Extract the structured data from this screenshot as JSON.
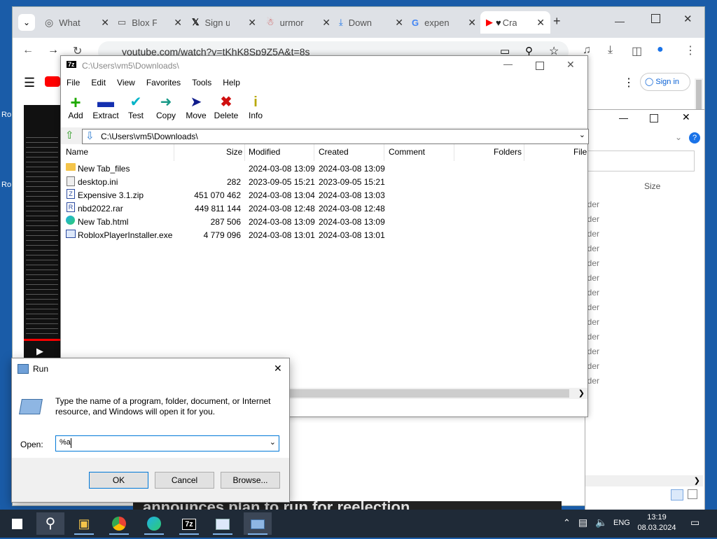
{
  "desktop": {
    "icon1_label": "Ro",
    "icon2_label": "Ro"
  },
  "browser": {
    "tabs": [
      {
        "title": "What",
        "icon": "globe-icon"
      },
      {
        "title": "Blox F",
        "icon": "page-icon"
      },
      {
        "title": "Sign u",
        "icon": "x-logo-icon"
      },
      {
        "title": "urmor",
        "icon": "bot-icon"
      },
      {
        "title": "Down",
        "icon": "download-icon"
      },
      {
        "title": "expen",
        "icon": "google-icon"
      },
      {
        "title": "Cra",
        "icon": "youtube-icon"
      }
    ],
    "url": "youtube.com/watch?v=tKhK8Sp9Z5A&t=8s",
    "sign_in": "Sign in",
    "video_caption": "announces plan to run for reelection"
  },
  "explorer": {
    "size_header": "Size",
    "folder_fragment": "lder",
    "rows": 13
  },
  "sevenzip": {
    "title": "C:\\Users\\vm5\\Downloads\\",
    "menu": [
      "File",
      "Edit",
      "View",
      "Favorites",
      "Tools",
      "Help"
    ],
    "tools": [
      "Add",
      "Extract",
      "Test",
      "Copy",
      "Move",
      "Delete",
      "Info"
    ],
    "address": "C:\\Users\\vm5\\Downloads\\",
    "columns": [
      "Name",
      "Size",
      "Modified",
      "Created",
      "Comment",
      "Folders",
      "File"
    ],
    "files": [
      {
        "name": "New Tab_files",
        "size": "",
        "modified": "2024-03-08 13:09",
        "created": "2024-03-08 13:09",
        "icon": "folder-icon"
      },
      {
        "name": "desktop.ini",
        "size": "282",
        "modified": "2023-09-05 15:21",
        "created": "2023-09-05 15:21",
        "icon": "ini-file-icon"
      },
      {
        "name": "Expensive 3.1.zip",
        "size": "451 070 462",
        "modified": "2024-03-08 13:04",
        "created": "2024-03-08 13:03",
        "icon": "zip-file-icon"
      },
      {
        "name": "nbd2022.rar",
        "size": "449 811 144",
        "modified": "2024-03-08 12:48",
        "created": "2024-03-08 12:48",
        "icon": "rar-file-icon"
      },
      {
        "name": "New Tab.html",
        "size": "287 506",
        "modified": "2024-03-08 13:09",
        "created": "2024-03-08 13:09",
        "icon": "edge-html-icon"
      },
      {
        "name": "RobloxPlayerInstaller.exe",
        "size": "4 779 096",
        "modified": "2024-03-08 13:01",
        "created": "2024-03-08 13:01",
        "icon": "exe-file-icon"
      }
    ]
  },
  "run": {
    "title": "Run",
    "description": "Type the name of a program, folder, document, or Internet resource, and Windows will open it for you.",
    "open_label": "Open:",
    "open_value": "%a",
    "ok": "OK",
    "cancel": "Cancel",
    "browse": "Browse..."
  },
  "taskbar": {
    "lang": "ENG",
    "time": "13:19",
    "date": "08.03.2024"
  }
}
